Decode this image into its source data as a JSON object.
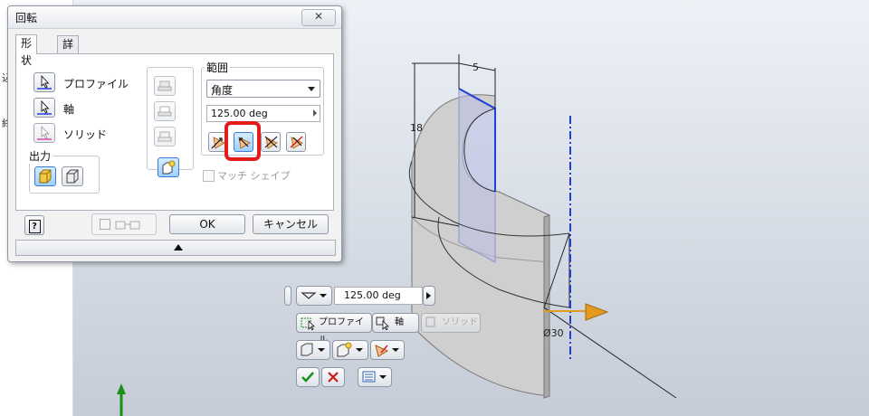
{
  "dialog": {
    "title": "回転",
    "close_label": "✕",
    "tabs": [
      {
        "label": "形状",
        "active": true
      },
      {
        "label": "詳細",
        "active": false
      }
    ],
    "inputs": {
      "profile_label": "プロファイル",
      "axis_label": "軸",
      "solid_label": "ソリッド"
    },
    "output_label": "出力",
    "extent": {
      "group_label": "範囲",
      "type_value": "角度",
      "angle_value": "125.00 deg"
    },
    "match_shape_label": "マッチ シェイプ",
    "ok_label": "OK",
    "cancel_label": "キャンセル",
    "help_label": "?"
  },
  "mini_toolbar": {
    "angle_value": "125.00 deg",
    "profile_label": "プロファイル",
    "axis_label": "軸",
    "solid_label": "ソリッド"
  },
  "dimensions": {
    "width": "5",
    "height": "18",
    "diameter": "Ø30"
  },
  "left_panel": {
    "text1": "込",
    "text2": "終"
  },
  "colors": {
    "highlight": "#e21b1b",
    "axis_line": "#1f3fd6",
    "arrow": "#e39a1e"
  }
}
